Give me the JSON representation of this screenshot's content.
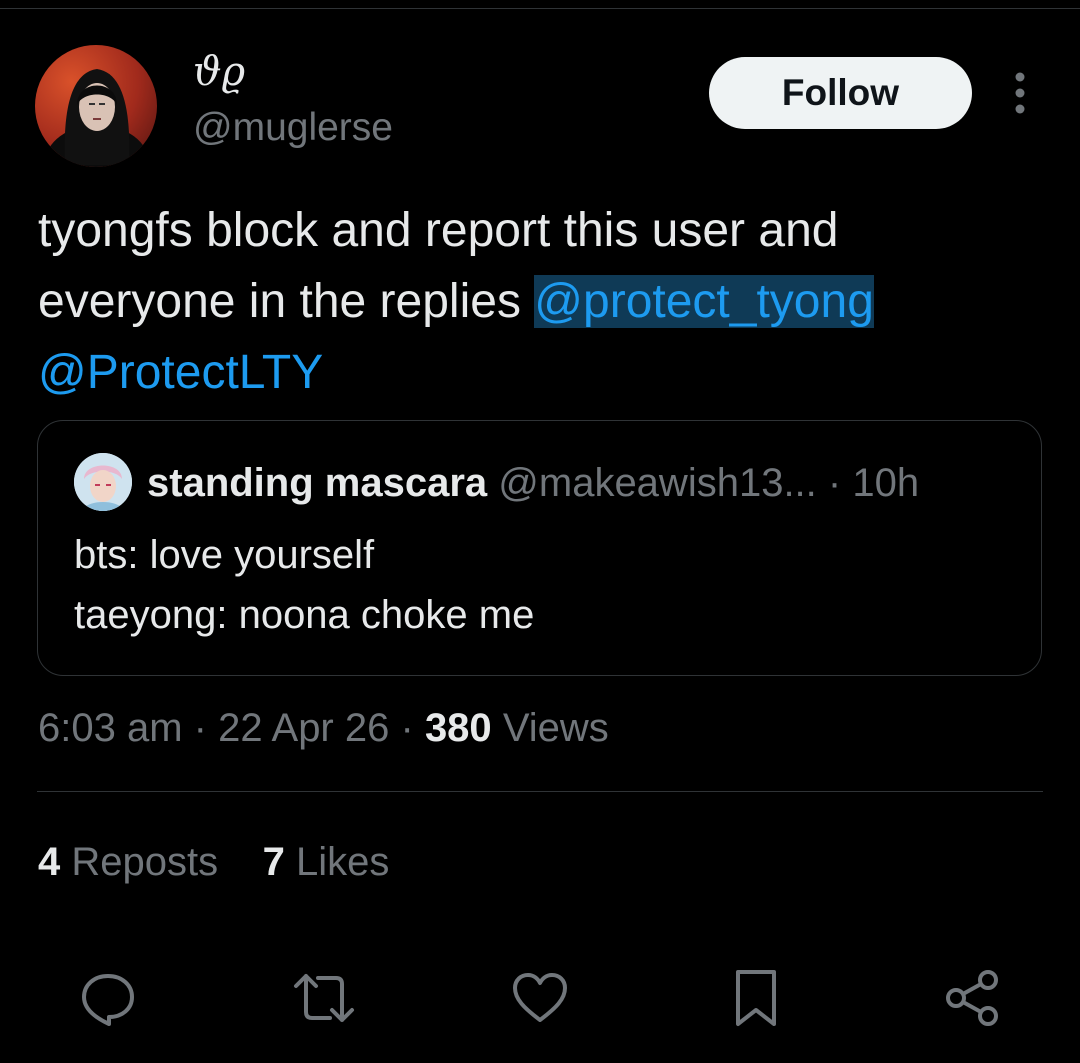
{
  "author": {
    "display_name": "ϑϱ",
    "handle": "@muglerse",
    "follow_label": "Follow"
  },
  "tweet": {
    "text_start": "tyongfs block and report this user and everyone in the replies ",
    "mention_1": "@protect_tyong",
    "mention_2": "@ProtectLTY"
  },
  "quote": {
    "name": "standing mascara",
    "handle": "@makeawish13...",
    "time": "· 10h",
    "line_1": "bts: love yourself",
    "line_2": "taeyong: noona choke me"
  },
  "meta": {
    "time": "6:03 am",
    "sep_1": "·",
    "date": "22 Apr 26",
    "sep_2": "·",
    "views_count": "380",
    "views_label": "Views"
  },
  "stats": {
    "reposts_count": "4",
    "reposts_label": "Reposts",
    "likes_count": "7",
    "likes_label": "Likes"
  },
  "actions": [
    "reply-icon",
    "repost-icon",
    "like-icon",
    "bookmark-icon",
    "share-icon"
  ],
  "colors": {
    "background": "#000000",
    "text": "#e7e9ea",
    "secondary": "#71767b",
    "link": "#1d9bf0",
    "link_highlight": "#0f3a56",
    "border": "#2f3336"
  }
}
